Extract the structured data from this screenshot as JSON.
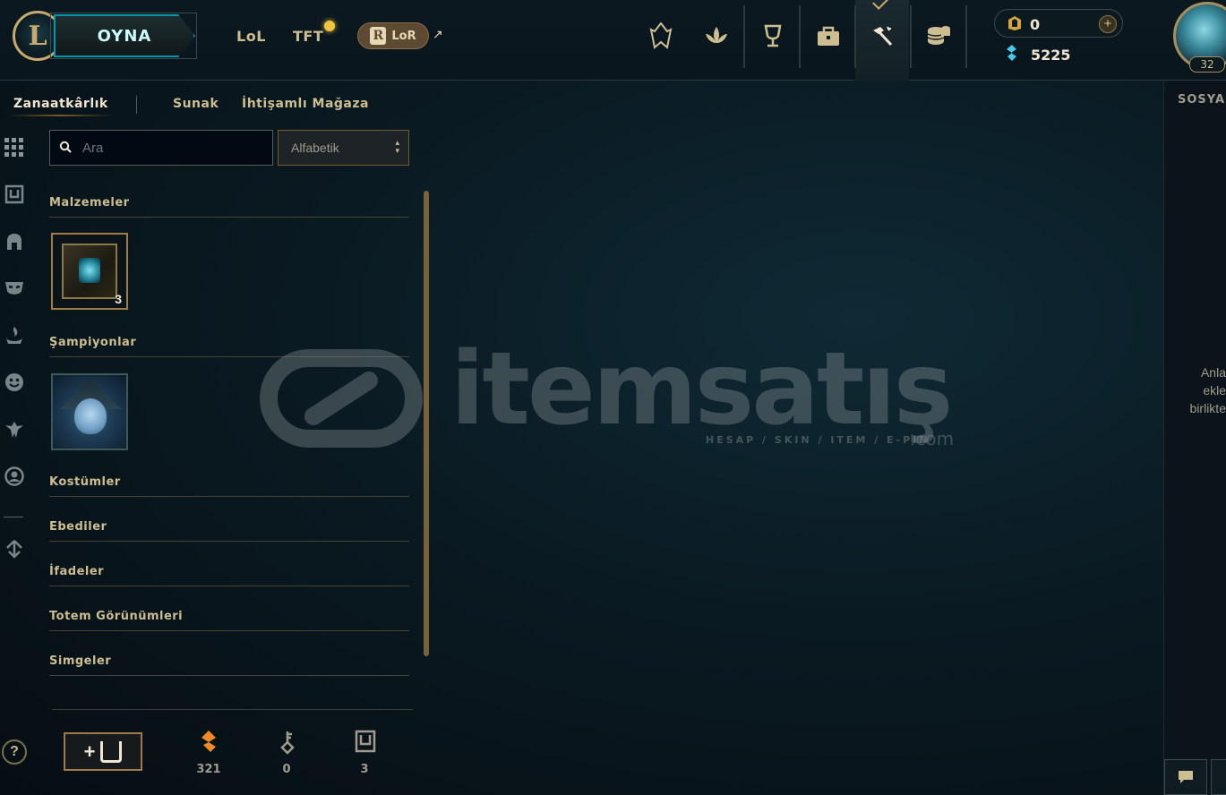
{
  "header": {
    "logo_letter": "L",
    "play_label": "OYNA",
    "tabs": [
      "LoL",
      "TFT"
    ],
    "lor_label": "LoR",
    "lor_badge": "R",
    "external_arrow": "↗",
    "nav_icons": [
      "champions-icon",
      "loot-flower-icon",
      "trophy-icon",
      "collection-bag-icon",
      "crafting-hammer-icon",
      "store-coins-icon"
    ],
    "rp_value": "0",
    "rp_plus": "+",
    "be_value": "5225",
    "level": "32"
  },
  "subnav": {
    "items": [
      "Zanaatkârlık",
      "Sunak",
      "İhtişamlı Mağaza"
    ]
  },
  "rail": {
    "icons": [
      "grid-icon",
      "chest-icon",
      "helmet-icon",
      "mask-icon",
      "ward-icon",
      "emote-icon",
      "totem-icon",
      "profile-icon",
      "arrow-icon"
    ],
    "help": "?"
  },
  "search": {
    "placeholder": "Ara"
  },
  "sort": {
    "selected": "Alfabetik"
  },
  "sections": {
    "materials": "Malzemeler",
    "champions": "Şampiyonlar",
    "skins": "Kostümler",
    "eternals": "Ebediler",
    "emotes": "İfadeler",
    "wards": "Totem Görünümleri",
    "icons": "Simgeler"
  },
  "items": {
    "chest_count": "3"
  },
  "bottom": {
    "craft_plus": "+",
    "essence_value": "321",
    "keys_value": "0",
    "chests_value": "3"
  },
  "watermark": {
    "brand": "itemsatış",
    "tagline": "HESAP / SKIN / ITEM / E-PIN",
    "dotcom": ".com"
  },
  "social": {
    "title": "SOSYAL",
    "lines": [
      "Anla",
      "ekle",
      "birlikte"
    ]
  },
  "colors": {
    "gold": "#c8aa6e",
    "teal": "#0596aa",
    "blue_essence": "#48c8e8",
    "orange_essence": "#f08a28"
  }
}
